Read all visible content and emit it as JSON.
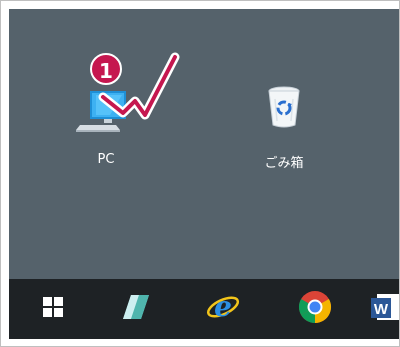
{
  "desktop": {
    "icons": [
      {
        "label": "PC",
        "icon": "pc-icon"
      },
      {
        "label": "ごみ箱",
        "icon": "recycle-bin-icon"
      }
    ],
    "callout": {
      "number": "1",
      "color": "#c5174f"
    }
  },
  "taskbar": {
    "apps": [
      {
        "name": "start",
        "icon": "windows-start-icon"
      },
      {
        "name": "notepad",
        "icon": "notepad-app-icon"
      },
      {
        "name": "internet-explorer",
        "icon": "internet-explorer-icon"
      },
      {
        "name": "chrome",
        "icon": "chrome-icon"
      },
      {
        "name": "word",
        "icon": "word-icon",
        "letter": "W"
      }
    ]
  },
  "colors": {
    "desktop_bg": "#55626b",
    "taskbar_bg": "#1e2225",
    "accent": "#c5174f"
  }
}
